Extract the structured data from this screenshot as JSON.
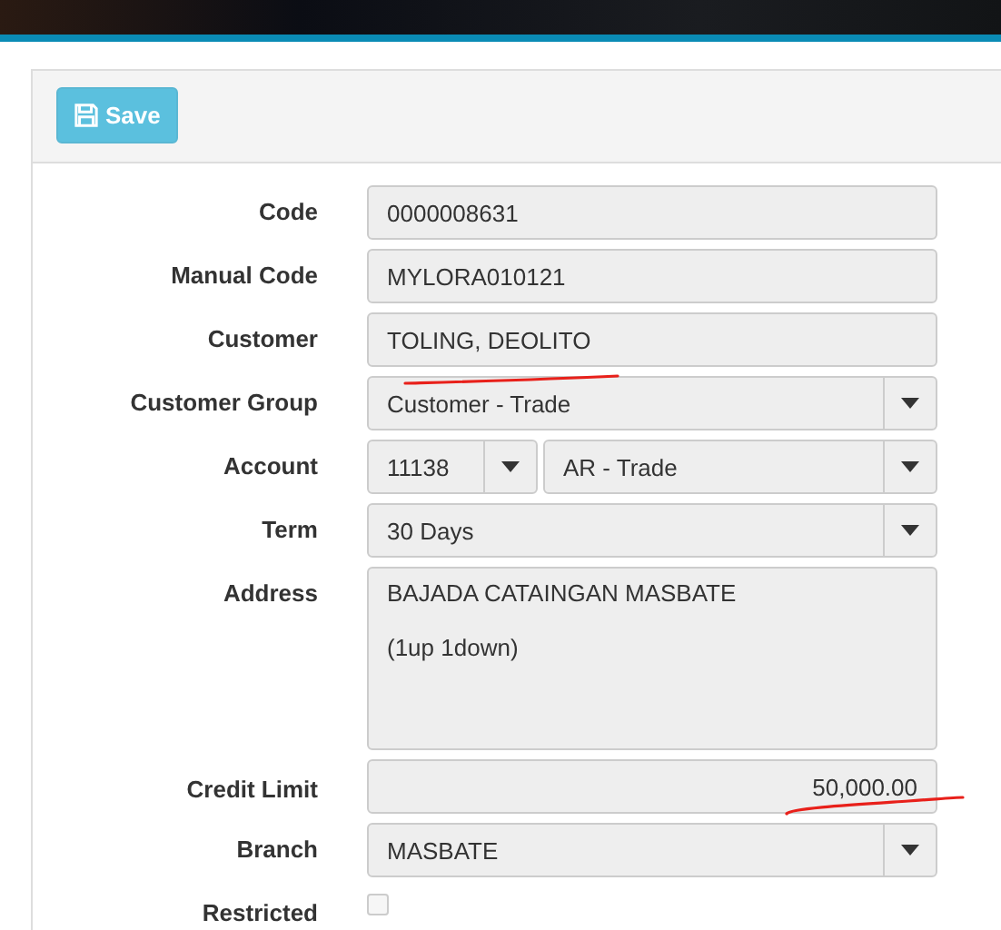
{
  "toolbar": {
    "save_button": "Save"
  },
  "fields": [
    {
      "kind": "text",
      "label": "Code",
      "value": "0000008631"
    },
    {
      "kind": "text",
      "label": "Manual Code",
      "value": "MYLORA010121"
    },
    {
      "kind": "text",
      "label": "Customer",
      "value": "TOLING, DEOLITO"
    },
    {
      "kind": "select",
      "label": "Customer Group",
      "value": "Customer - Trade"
    },
    {
      "kind": "pair",
      "label": "Account",
      "value": "11138",
      "value_2": "AR - Trade"
    },
    {
      "kind": "select",
      "label": "Term",
      "value": "30 Days"
    },
    {
      "kind": "textarea",
      "label": "Address",
      "value": "BAJADA CATAINGAN MASBATE\n\n(1up 1down)"
    },
    {
      "kind": "number",
      "label": "Credit Limit",
      "value": "50,000.00"
    },
    {
      "kind": "select",
      "label": "Branch",
      "value": "MASBATE"
    },
    {
      "kind": "checkbox",
      "label": "Restricted",
      "checked": false
    }
  ]
}
